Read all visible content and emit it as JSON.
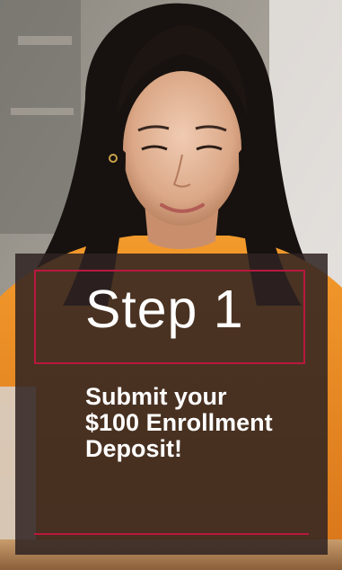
{
  "step": {
    "title": "Step 1",
    "description": "Submit your $100 Enrollment Deposit!"
  },
  "colors": {
    "overlay": "#2e2322",
    "accent": "#b8183f",
    "text": "#ffffff",
    "sweater": "#f08a1c",
    "hair": "#17120f"
  }
}
